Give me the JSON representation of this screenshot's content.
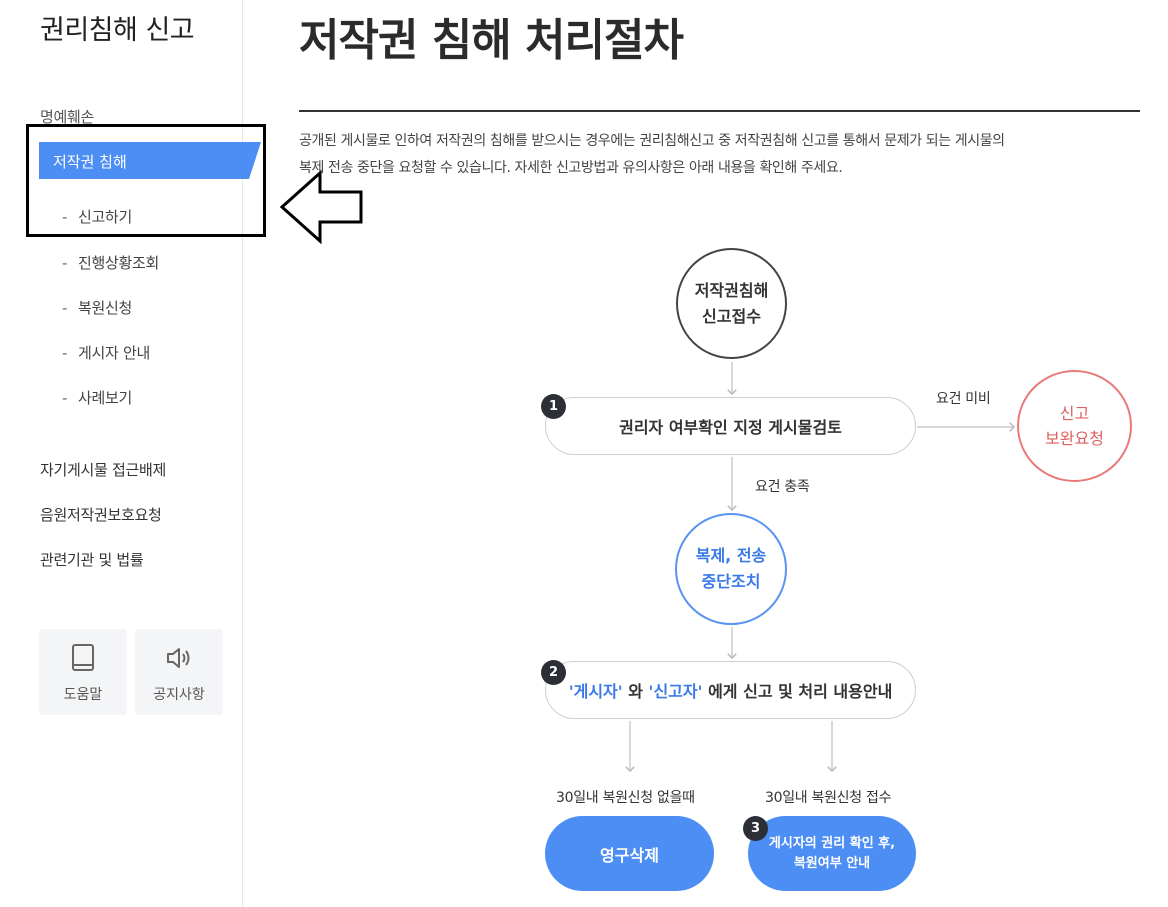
{
  "sidebar": {
    "title": "권리침해 신고",
    "defamation": "명예훼손",
    "active": "저작권 침해",
    "sub_items": [
      "신고하기",
      "진행상황조회",
      "복원신청",
      "게시자 안내",
      "사례보기"
    ],
    "menu": [
      "자기게시물 접근배제",
      "음원저작권보호요청",
      "관련기관 및 법률"
    ],
    "quick": {
      "help": {
        "label": "도움말",
        "icon": "book-icon"
      },
      "notice": {
        "label": "공지사항",
        "icon": "speaker-icon"
      }
    }
  },
  "main": {
    "title": "저작권 침해 처리절차",
    "intro": [
      "공개된 게시물로 인하여 저작권의 침해를 받으시는 경우에는 권리침해신고 중 저작권침해 신고를 통해서 문제가 되는 게시물의",
      "복제 전송 중단을 요청할 수 있습니다. 자세한 신고방법과 유의사항은 아래 내용을 확인해 주세요."
    ]
  },
  "flow": {
    "start_line1": "저작권침해",
    "start_line2": "신고접수",
    "step1_badge": "1",
    "step1": "권리자 여부확인 지정 게시물검토",
    "missing_label": "요건 미비",
    "supplement_line1": "신고",
    "supplement_line2": "보완요청",
    "met_label": "요건 충족",
    "stop_line1": "복제, 전송",
    "stop_line2": "중단조치",
    "step2_badge": "2",
    "step2_poster": "'게시자'",
    "step2_and": " 와 ",
    "step2_reporter": "'신고자'",
    "step2_rest": " 에게 신고 및 처리 내용안내",
    "none_label": "30일내 복원신청 없을때",
    "recv_label": "30일내 복원신청 접수",
    "delete": "영구삭제",
    "step3_badge": "3",
    "restore_line1": "게시자의 권리 확인 후,",
    "restore_line2": "복원여부 안내"
  },
  "colors": {
    "accent_blue": "#4d8ef4",
    "text_blue": "#3a7ae8",
    "alert_red": "#e06060",
    "badge_dark": "#2c2f36"
  }
}
